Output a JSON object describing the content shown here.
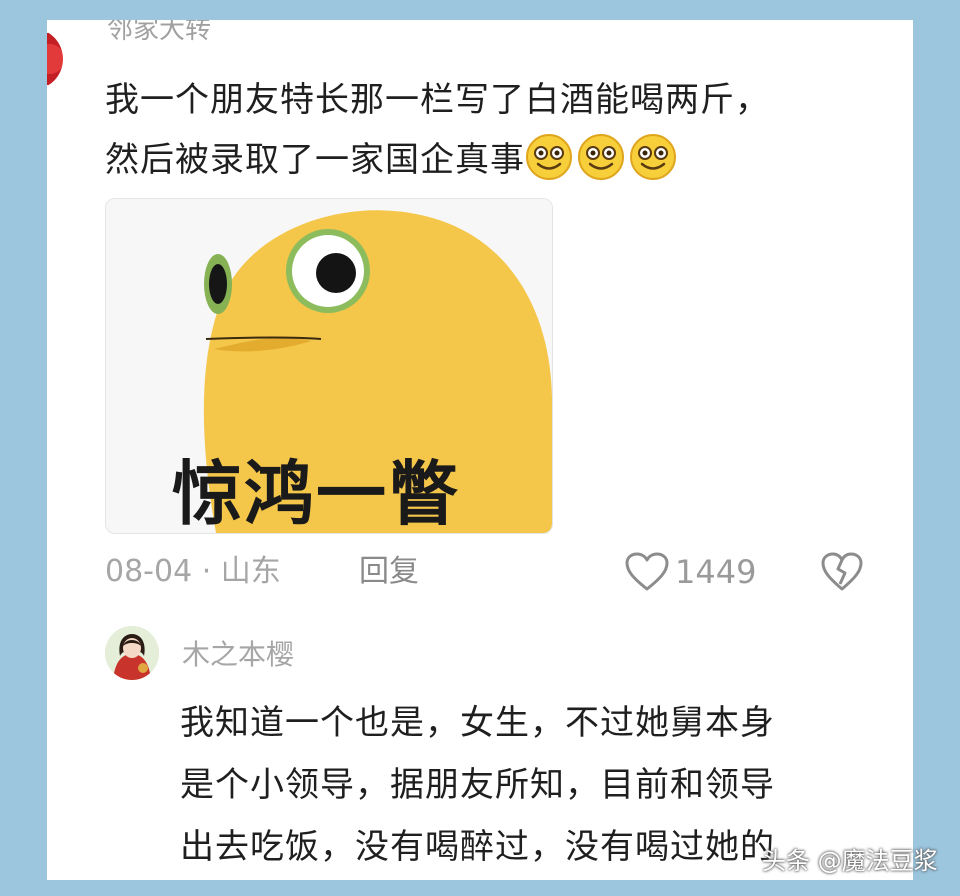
{
  "comment1": {
    "username": "邻家大转",
    "text_line1": "我一个朋友特长那一栏写了白酒能喝两斤，",
    "text_line2": "然后被录取了一家国企真事",
    "emoji": [
      "smile-emoji",
      "smile-emoji",
      "smile-emoji"
    ],
    "sticker_caption": "惊鸿一瞥",
    "date_location": "08-04 · 山东",
    "reply_label": "回复",
    "like_count": "1449"
  },
  "comment2": {
    "username": "木之本樱",
    "text_line1": "我知道一个也是，女生，不过她舅本身",
    "text_line2": "是个小领导，据朋友所知，目前和领导",
    "text_line3": "出去吃饭，没有喝醉过，没有喝过她的"
  },
  "watermark": "头条 @魔法豆浆",
  "colors": {
    "background": "#9cc5de",
    "card": "#ffffff",
    "text": "#1f1f1f",
    "muted": "#a6a6a6",
    "sticker_yellow": "#f5c44a"
  }
}
